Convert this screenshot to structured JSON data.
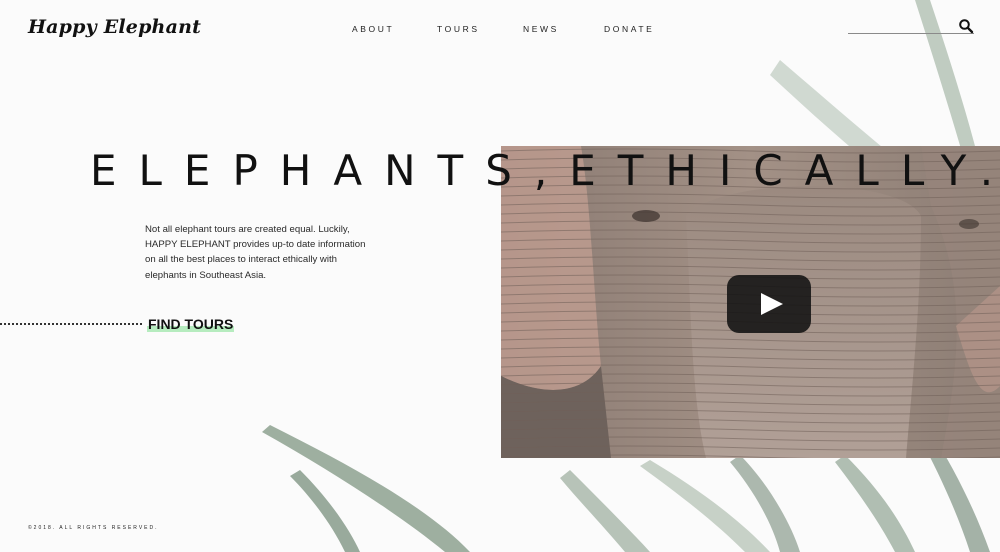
{
  "brand": {
    "logo": "Happy Elephant"
  },
  "nav": {
    "items": [
      "ABOUT",
      "TOURS",
      "NEWS",
      "DONATE"
    ]
  },
  "search": {
    "icon": "search-icon"
  },
  "hero": {
    "title": "ELEPHANTS,ETHICALLY.",
    "intro": "Not all elephant tours are created equal. Luckily, HAPPY ELEPHANT provides up-to date information on all the best places to interact ethically with elephants in Southeast Asia.",
    "cta": "FIND TOURS"
  },
  "video": {
    "play_icon": "play-icon"
  },
  "footer": {
    "copyright": "©2018. ALL RIGHTS RESERVED."
  },
  "colors": {
    "accent_highlight": "#b6ecbf",
    "leaf": "#7f9682",
    "text": "#111111"
  }
}
